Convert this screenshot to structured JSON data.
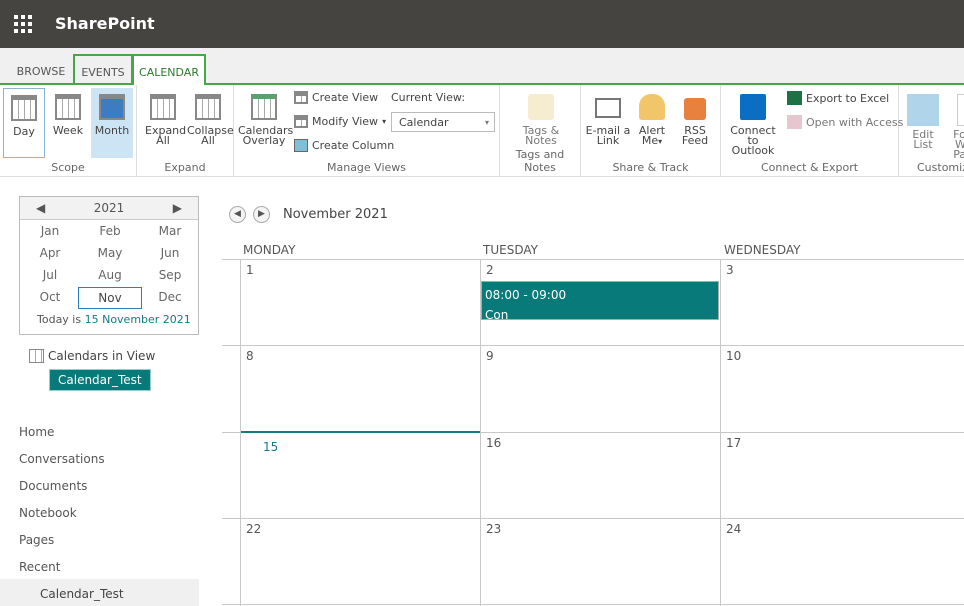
{
  "app": {
    "title": "SharePoint",
    "waffle_icon": "waffle-icon"
  },
  "tabs": [
    {
      "label": "BROWSE"
    },
    {
      "label": "EVENTS"
    },
    {
      "label": "CALENDAR",
      "selected": true
    }
  ],
  "ribbon": {
    "scope": {
      "label": "Scope",
      "day": "Day",
      "week": "Week",
      "month": "Month",
      "selected": "Month"
    },
    "expand": {
      "label": "Expand",
      "expand_all": [
        "Expand",
        "All"
      ],
      "collapse_all": [
        "Collapse",
        "All"
      ]
    },
    "manage_views": {
      "label": "Manage Views",
      "overlay": [
        "Calendars",
        "Overlay"
      ],
      "create_view": "Create View",
      "modify_view": "Modify View",
      "create_column": "Create Column",
      "current_view_label": "Current View:",
      "current_view_value": "Calendar"
    },
    "tags": {
      "label": "Tags and Notes",
      "tags_notes": [
        "Tags &",
        "Notes"
      ]
    },
    "share": {
      "label": "Share & Track",
      "email": [
        "E-mail a",
        "Link"
      ],
      "alert": [
        "Alert",
        "Me"
      ],
      "rss": [
        "RSS",
        "Feed"
      ]
    },
    "connect": {
      "label": "Connect & Export",
      "outlook": [
        "Connect to",
        "Outlook"
      ],
      "excel": "Export to Excel",
      "access": "Open with Access"
    },
    "customize": {
      "label": "Customize",
      "edit_list": [
        "Edit",
        "List"
      ],
      "form": [
        "Form",
        "Web Parts"
      ]
    }
  },
  "minical": {
    "year": "2021",
    "months": [
      "Jan",
      "Feb",
      "Mar",
      "Apr",
      "May",
      "Jun",
      "Jul",
      "Aug",
      "Sep",
      "Oct",
      "Nov",
      "Dec"
    ],
    "selected": "Nov",
    "today_prefix": "Today is ",
    "today_date": "15 November 2021"
  },
  "calendars_in_view": {
    "label": "Calendars in View",
    "items": [
      "Calendar_Test"
    ]
  },
  "nav": {
    "items": [
      "Home",
      "Conversations",
      "Documents",
      "Notebook",
      "Pages",
      "Recent"
    ],
    "recent_item": "Calendar_Test"
  },
  "calendar": {
    "title": "November 2021",
    "days": [
      "MONDAY",
      "TUESDAY",
      "WEDNESDAY"
    ],
    "weeks": [
      [
        "1",
        "2",
        "3"
      ],
      [
        "8",
        "9",
        "10"
      ],
      [
        "15",
        "16",
        "17"
      ],
      [
        "22",
        "23",
        "24"
      ]
    ],
    "today": "15",
    "event": {
      "time": "08:00 - 09:00",
      "title": "Con",
      "color": "#087a7a"
    }
  }
}
